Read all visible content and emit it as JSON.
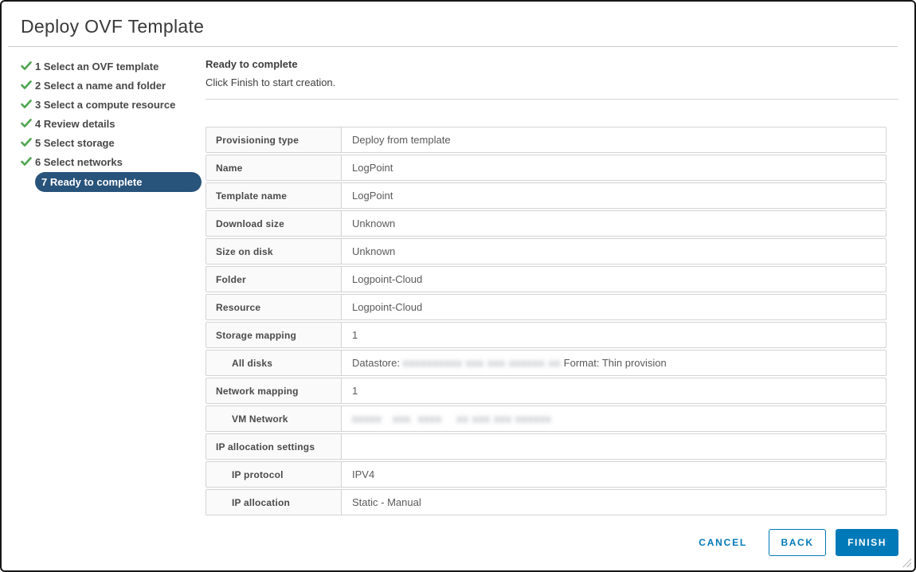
{
  "dialog": {
    "title": "Deploy OVF Template"
  },
  "sidebar": {
    "steps": [
      {
        "num": "1",
        "label": "Select an OVF template",
        "state": "completed"
      },
      {
        "num": "2",
        "label": "Select a name and folder",
        "state": "completed"
      },
      {
        "num": "3",
        "label": "Select a compute resource",
        "state": "completed"
      },
      {
        "num": "4",
        "label": "Review details",
        "state": "completed"
      },
      {
        "num": "5",
        "label": "Select storage",
        "state": "completed"
      },
      {
        "num": "6",
        "label": "Select networks",
        "state": "completed"
      },
      {
        "num": "7",
        "label": "Ready to complete",
        "state": "active"
      }
    ]
  },
  "panel": {
    "heading": "Ready to complete",
    "subheading": "Click Finish to start creation."
  },
  "summary": {
    "rows": [
      {
        "label": "Provisioning type",
        "indent": false,
        "segments": [
          {
            "text": "Deploy from template"
          }
        ]
      },
      {
        "label": "Name",
        "indent": false,
        "segments": [
          {
            "text": "LogPoint"
          }
        ]
      },
      {
        "label": "Template name",
        "indent": false,
        "segments": [
          {
            "text": "LogPoint"
          }
        ]
      },
      {
        "label": "Download size",
        "indent": false,
        "segments": [
          {
            "text": "Unknown"
          }
        ]
      },
      {
        "label": "Size on disk",
        "indent": false,
        "segments": [
          {
            "text": "Unknown"
          }
        ]
      },
      {
        "label": "Folder",
        "indent": false,
        "segments": [
          {
            "text": "Logpoint-Cloud"
          }
        ]
      },
      {
        "label": "Resource",
        "indent": false,
        "segments": [
          {
            "text": "Logpoint-Cloud"
          }
        ]
      },
      {
        "label": "Storage mapping",
        "indent": false,
        "segments": [
          {
            "text": "1"
          }
        ]
      },
      {
        "label": "All disks",
        "indent": true,
        "segments": [
          {
            "text": "Datastore: "
          },
          {
            "text": "xxxxxxxxxx xxx xxx xxxxxx xx",
            "redacted": true
          },
          {
            "text": " Format: Thin provision"
          }
        ]
      },
      {
        "label": "Network mapping",
        "indent": false,
        "segments": [
          {
            "text": "1"
          }
        ]
      },
      {
        "label": "VM Network",
        "indent": true,
        "segments": [
          {
            "text": "xxxxx   xxx  xxxx    xx xxx xxx xxxxxx",
            "redacted": true
          }
        ]
      },
      {
        "label": "IP allocation settings",
        "indent": false,
        "segments": []
      },
      {
        "label": "IP protocol",
        "indent": true,
        "segments": [
          {
            "text": "IPV4"
          }
        ]
      },
      {
        "label": "IP allocation",
        "indent": true,
        "segments": [
          {
            "text": "Static - Manual"
          }
        ]
      }
    ]
  },
  "buttons": {
    "cancel": "CANCEL",
    "back": "BACK",
    "finish": "FINISH"
  },
  "colors": {
    "accent_blue": "#0079b8",
    "active_step_bg": "#28537a",
    "check_green": "#4EA550",
    "row_border": "#d3d3d3",
    "label_cell_bg": "#fafafa"
  }
}
